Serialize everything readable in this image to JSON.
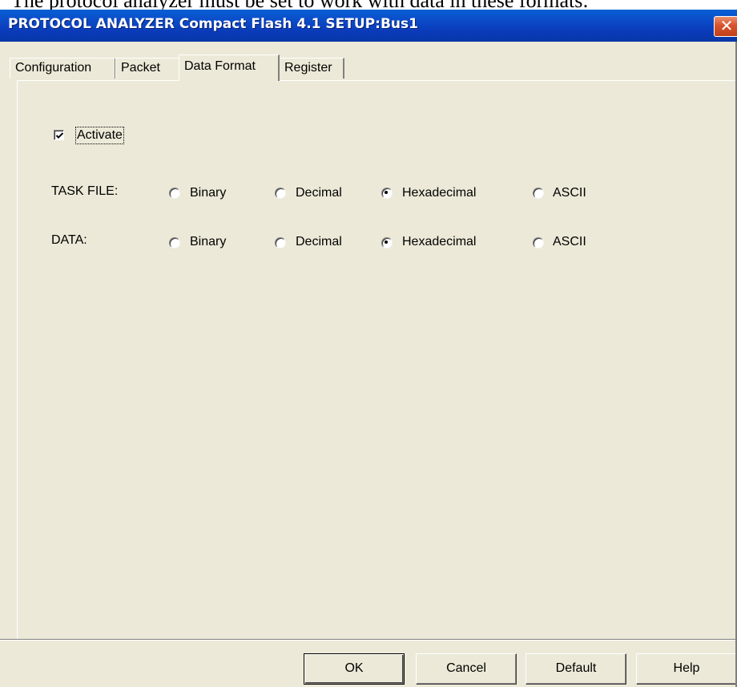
{
  "page_top_text": "The protocol analyzer must be set to work with data in these formats:",
  "window": {
    "title": "PROTOCOL ANALYZER Compact Flash 4.1 SETUP:Bus1",
    "close_glyph": "✕"
  },
  "tabs": [
    {
      "label": "Configuration",
      "active": false
    },
    {
      "label": "Packet",
      "active": false
    },
    {
      "label": "Data Format",
      "active": true
    },
    {
      "label": "Register",
      "active": false
    }
  ],
  "activate": {
    "label": "Activate",
    "checked": true
  },
  "rows": [
    {
      "label": "TASK FILE:",
      "options": [
        {
          "label": "Binary",
          "selected": false
        },
        {
          "label": "Decimal",
          "selected": false
        },
        {
          "label": "Hexadecimal",
          "selected": true
        },
        {
          "label": "ASCII",
          "selected": false
        }
      ]
    },
    {
      "label": "DATA:",
      "options": [
        {
          "label": "Binary",
          "selected": false
        },
        {
          "label": "Decimal",
          "selected": false
        },
        {
          "label": "Hexadecimal",
          "selected": true
        },
        {
          "label": "ASCII",
          "selected": false
        }
      ]
    }
  ],
  "buttons": {
    "ok": "OK",
    "cancel": "Cancel",
    "default": "Default",
    "help": "Help"
  }
}
